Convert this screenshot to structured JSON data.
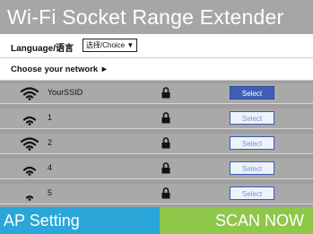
{
  "header": {
    "title": "Wi-Fi Socket Range Extender"
  },
  "language": {
    "label": "Language/语言",
    "selected": "选择/Choice ▼"
  },
  "network": {
    "label": "Choose your network ►"
  },
  "networks": [
    {
      "ssid": "YourSSID",
      "select_label": "Select",
      "signal_icon": "wifi-signal-icon",
      "lock_icon": "lock-icon"
    },
    {
      "ssid": "1",
      "select_label": "Select",
      "signal_icon": "wifi-signal-icon",
      "lock_icon": "lock-icon"
    },
    {
      "ssid": "2",
      "select_label": "Select",
      "signal_icon": "wifi-signal-icon",
      "lock_icon": "lock-icon"
    },
    {
      "ssid": "4",
      "select_label": "Select",
      "signal_icon": "wifi-signal-icon",
      "lock_icon": "lock-icon"
    },
    {
      "ssid": "5",
      "select_label": "Select",
      "signal_icon": "wifi-signal-icon",
      "lock_icon": "lock-icon"
    }
  ],
  "footer": {
    "ap_setting_label": "AP Setting",
    "scan_now_label": "SCAN NOW"
  },
  "colors": {
    "title_bar": "#a6a6a6",
    "list_bg": "#a9a9a9",
    "select_primary": "#4060b6",
    "ap_setting": "#2aa6d9",
    "scan_now": "#8fc74a"
  }
}
